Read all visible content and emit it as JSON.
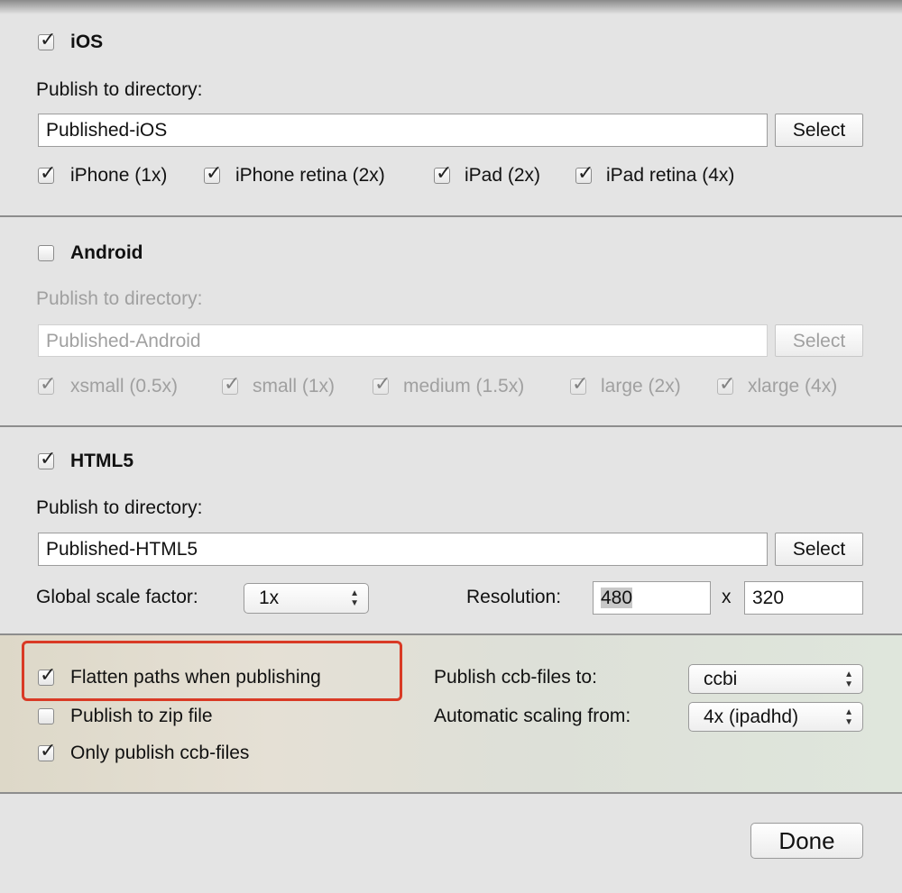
{
  "ios": {
    "label": "iOS",
    "checked": true,
    "dir_label": "Publish to directory:",
    "dir_value": "Published-iOS",
    "select": "Select",
    "options": [
      {
        "label": "iPhone (1x)",
        "checked": true
      },
      {
        "label": "iPhone retina (2x)",
        "checked": true
      },
      {
        "label": "iPad (2x)",
        "checked": true
      },
      {
        "label": "iPad retina (4x)",
        "checked": true
      }
    ]
  },
  "android": {
    "label": "Android",
    "checked": false,
    "dir_label": "Publish to directory:",
    "dir_value": "Published-Android",
    "select": "Select",
    "options": [
      {
        "label": "xsmall (0.5x)",
        "checked": true
      },
      {
        "label": "small (1x)",
        "checked": true
      },
      {
        "label": "medium (1.5x)",
        "checked": true
      },
      {
        "label": "large (2x)",
        "checked": true
      },
      {
        "label": "xlarge (4x)",
        "checked": true
      }
    ]
  },
  "html5": {
    "label": "HTML5",
    "checked": true,
    "dir_label": "Publish to directory:",
    "dir_value": "Published-HTML5",
    "select": "Select",
    "scale_label": "Global scale factor:",
    "scale_value": "1x",
    "resolution_label": "Resolution:",
    "res_width": "480",
    "res_sep": "x",
    "res_height": "320"
  },
  "general": {
    "flatten": {
      "label": "Flatten paths when publishing",
      "checked": true
    },
    "zip": {
      "label": "Publish to zip file",
      "checked": false
    },
    "only_ccb": {
      "label": "Only publish ccb-files",
      "checked": true
    },
    "ccb_label": "Publish ccb-files to:",
    "ccb_value": "ccbi",
    "scaling_label": "Automatic scaling from:",
    "scaling_value": "4x (ipadhd)"
  },
  "done": "Done",
  "highlight_color": "#d93a25"
}
